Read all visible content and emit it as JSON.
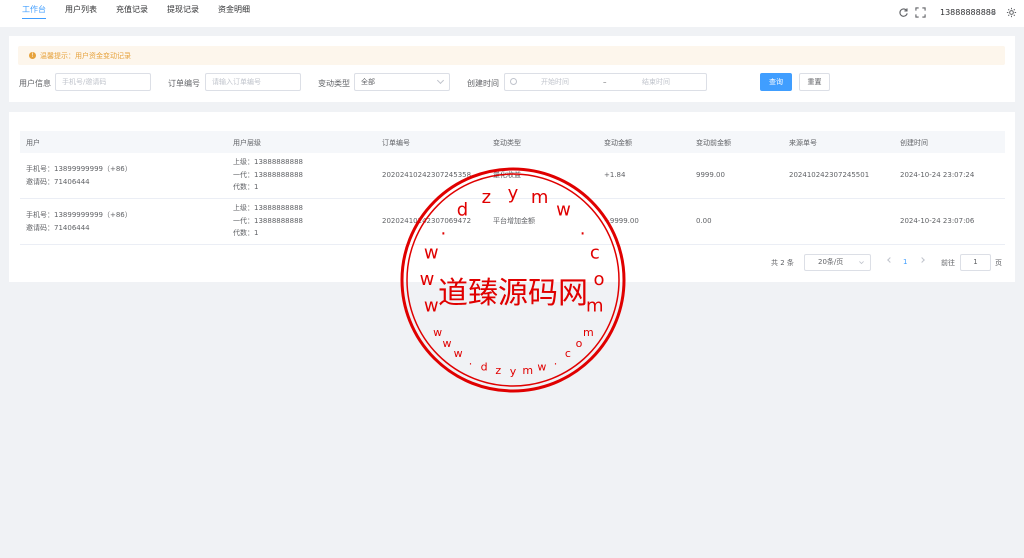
{
  "nav": {
    "tabs": [
      {
        "label": "工作台",
        "active": true
      },
      {
        "label": "用户列表"
      },
      {
        "label": "充值记录"
      },
      {
        "label": "提现记录"
      },
      {
        "label": "资金明细"
      }
    ],
    "user": "13888888888",
    "refresh_icon": "refresh-icon",
    "fullscreen_icon": "fullscreen-icon",
    "settings_icon": "gear-icon"
  },
  "filter": {
    "notice": "温馨提示：用户资金变动记录",
    "user_label": "用户信息",
    "user_placeholder": "手机号/邀请码",
    "order_label": "订单编号",
    "order_placeholder": "请输入订单编号",
    "type_label": "变动类型",
    "type_value": "全部",
    "date_label": "创建时间",
    "date_start": "开始时间",
    "date_sep": "–",
    "date_end": "结束时间",
    "search_btn": "查询",
    "reset_btn": "重置"
  },
  "table": {
    "headers": [
      "用户",
      "用户层级",
      "订单编号",
      "变动类型",
      "变动金额",
      "变动前金额",
      "来源单号",
      "创建时间"
    ],
    "rows": [
      {
        "user_phone": "手机号：13899999999（+86）",
        "user_invite": "邀请码：71406444",
        "level_up": "上级：13888888888",
        "level_gen1": "一代：13888888888",
        "level_count": "代数：1",
        "order_no": "20202410242307245358",
        "type": "量化收益",
        "amount": "+1.84",
        "before": "9999.00",
        "source": "202410242307245501",
        "created": "2024-10-24 23:07:24"
      },
      {
        "user_phone": "手机号：13899999999（+86）",
        "user_invite": "邀请码：71406444",
        "level_up": "上级：13888888888",
        "level_gen1": "一代：13888888888",
        "level_count": "代数：1",
        "order_no": "20202410242307069472",
        "type": "平台增加金额",
        "amount": "+9999.00",
        "before": "0.00",
        "source": "",
        "created": "2024-10-24 23:07:06"
      }
    ]
  },
  "pagination": {
    "total": "共 2 条",
    "page_size": "20条/页",
    "current_page": "1",
    "goto_label": "前往",
    "goto_value": "1",
    "page_suffix": "页"
  },
  "watermark": {
    "center_text": "道臻源码网",
    "ring_text": "www.dzymw.com",
    "color": "#e00000"
  }
}
